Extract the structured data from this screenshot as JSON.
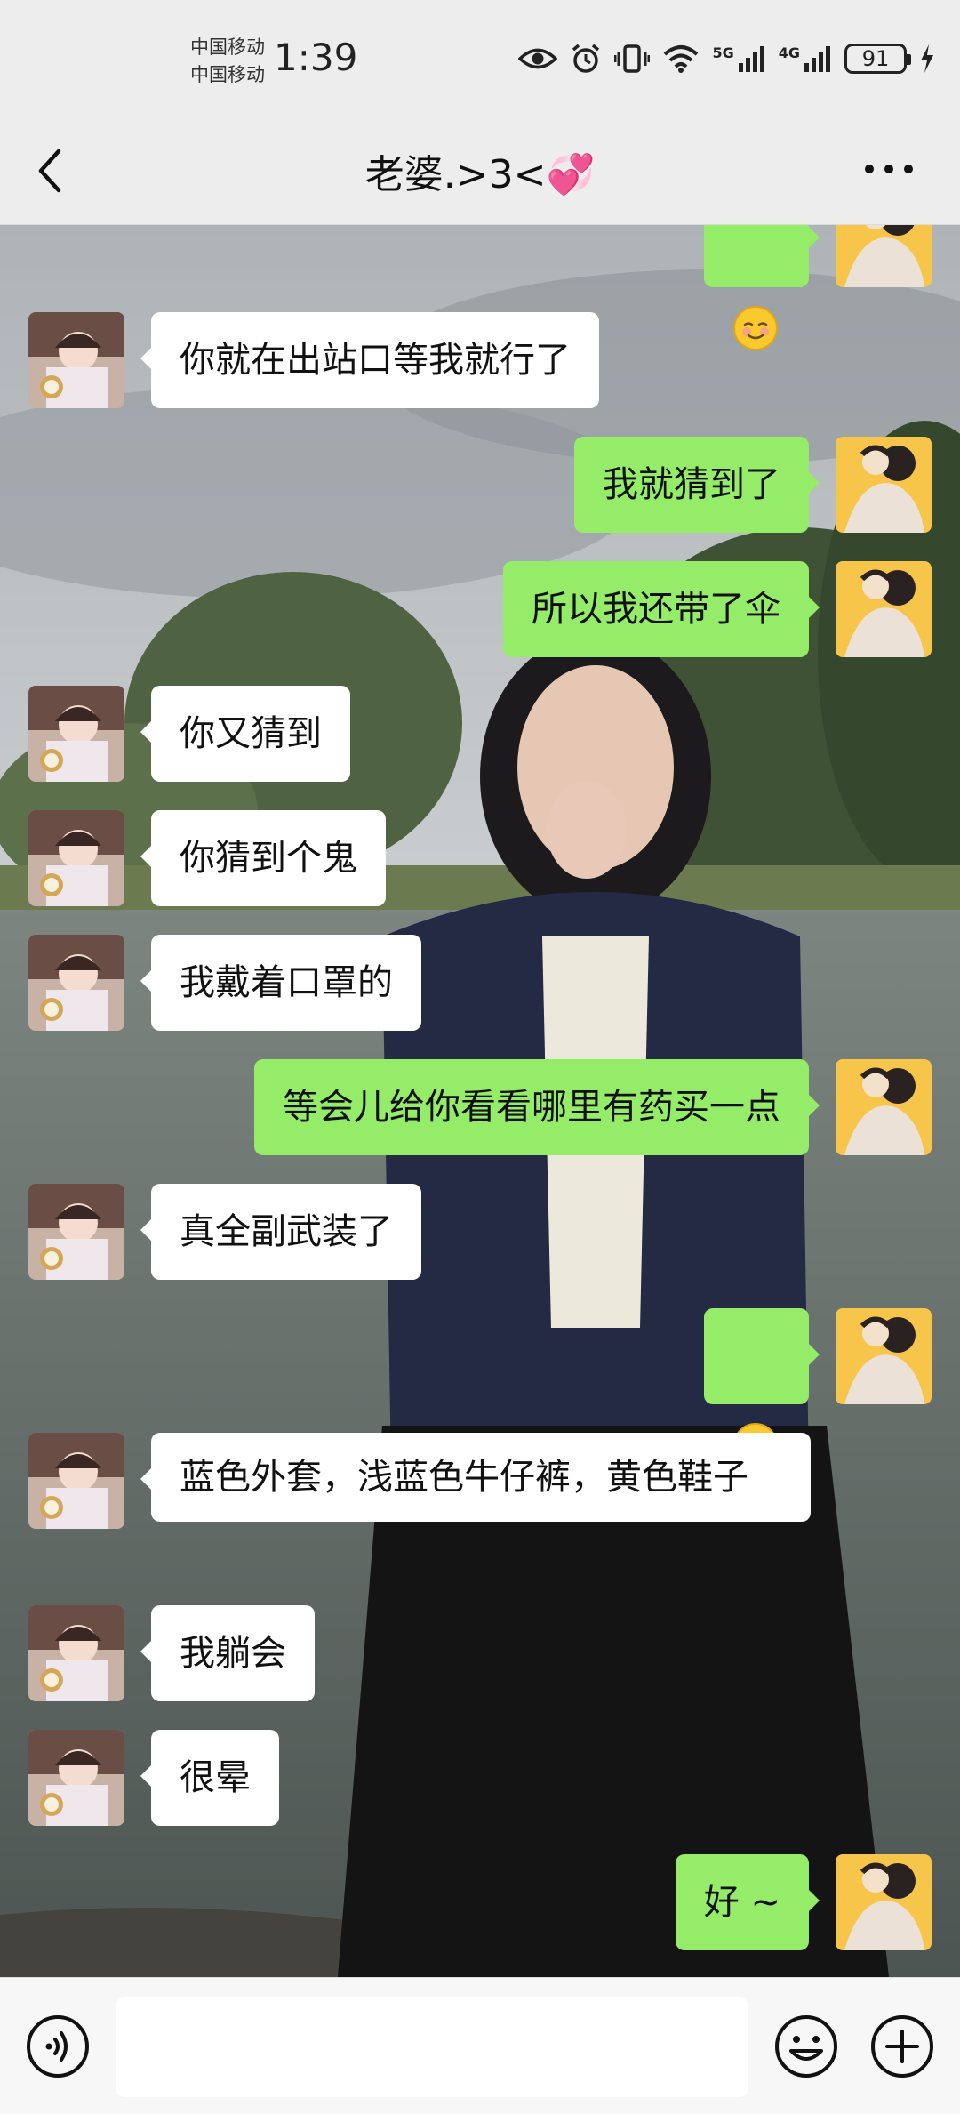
{
  "status_bar": {
    "carrier_1": "中国移动",
    "carrier_2": "中国移动",
    "time": "1:39",
    "signal_1": "5G",
    "signal_2": "4G",
    "battery": "91"
  },
  "header": {
    "title": "老婆.>3<💞"
  },
  "messages": [
    {
      "side": "out",
      "type": "emoji",
      "text": "",
      "icon": "smiling-face-emoji"
    },
    {
      "side": "in",
      "type": "text",
      "text": "你就在出站口等我就行了"
    },
    {
      "side": "out",
      "type": "text",
      "text": "我就猜到了"
    },
    {
      "side": "out",
      "type": "text",
      "text": "所以我还带了伞"
    },
    {
      "side": "in",
      "type": "text",
      "text": "你又猜到"
    },
    {
      "side": "in",
      "type": "text",
      "text": "你猜到个鬼"
    },
    {
      "side": "in",
      "type": "text",
      "text": "我戴着口罩的"
    },
    {
      "side": "out",
      "type": "text",
      "text": "等会儿给你看看哪里有药买一点"
    },
    {
      "side": "in",
      "type": "text",
      "text": "真全副武装了"
    },
    {
      "side": "out",
      "type": "emoji",
      "text": "",
      "icon": "smiling-face-emoji"
    },
    {
      "side": "in",
      "type": "text",
      "text": "蓝色外套，浅蓝色牛仔裤，黄色鞋子"
    },
    {
      "side": "in",
      "type": "text",
      "text": "我躺会"
    },
    {
      "side": "in",
      "type": "text",
      "text": "很晕"
    },
    {
      "side": "out",
      "type": "text",
      "text": "好 ~"
    }
  ],
  "input_bar": {
    "placeholder": "",
    "voice_icon": "voice-icon",
    "emoji_icon": "emoji-icon",
    "plus_icon": "plus-icon"
  },
  "colors": {
    "bar_bg": "#ededed",
    "incoming_bubble": "#ffffff",
    "outgoing_bubble": "#95ec69"
  }
}
